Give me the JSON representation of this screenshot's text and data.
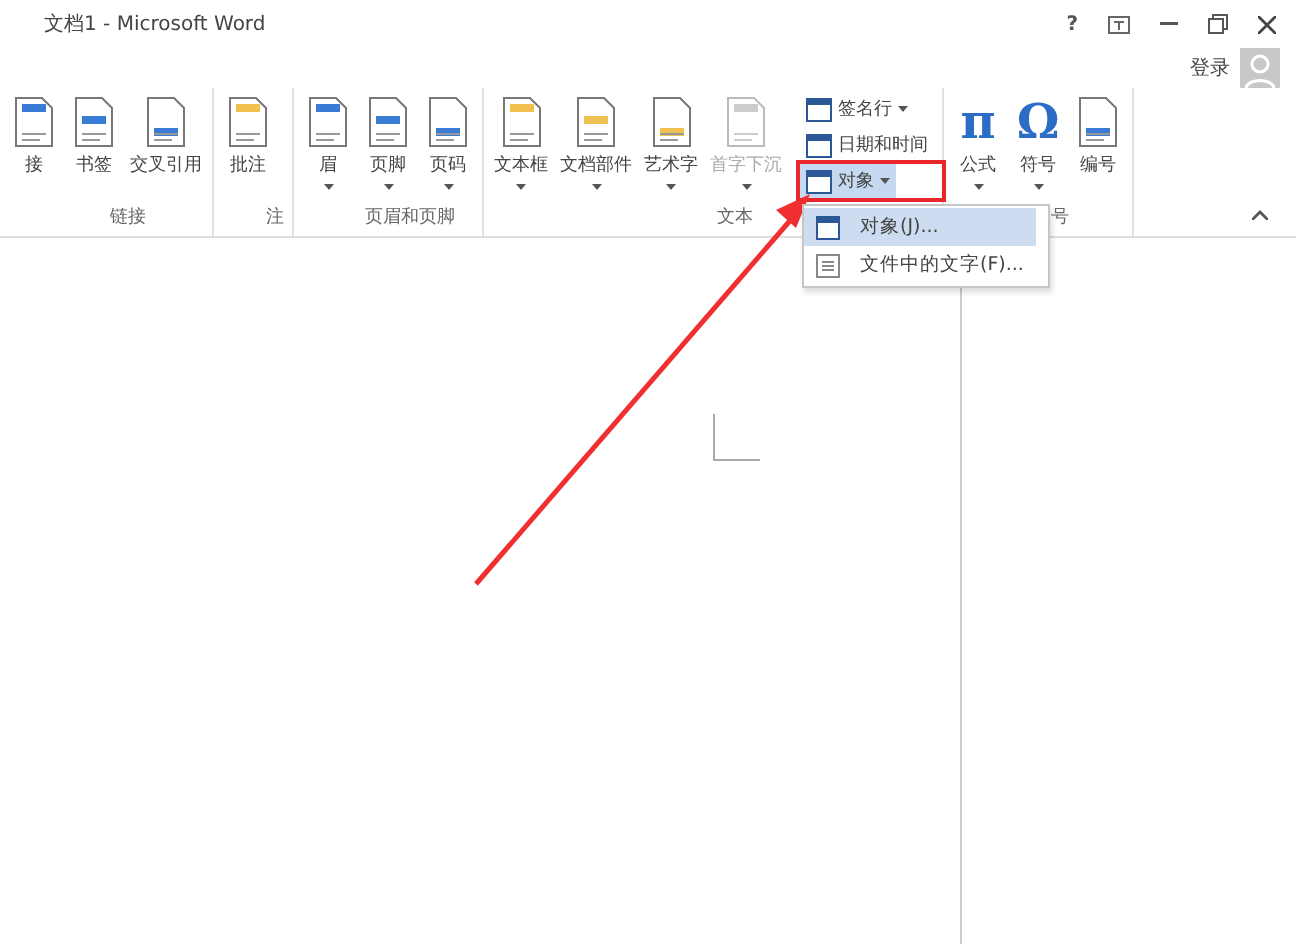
{
  "window": {
    "title": "文档1 - Microsoft Word",
    "help": "?",
    "sign_in": "登录"
  },
  "ribbon": {
    "groups": [
      {
        "label": "链接",
        "buttons": [
          {
            "label": "接",
            "kind": "large",
            "dropdown": false,
            "disabled": false
          },
          {
            "label": "书签",
            "kind": "large",
            "dropdown": false,
            "disabled": false
          },
          {
            "label": "交叉引用",
            "kind": "large",
            "dropdown": false,
            "disabled": false
          }
        ]
      },
      {
        "label": "注",
        "buttons": [
          {
            "label": "批注",
            "kind": "large",
            "dropdown": false,
            "disabled": false
          }
        ]
      },
      {
        "label": "页眉和页脚",
        "buttons": [
          {
            "label": "眉",
            "kind": "large",
            "dropdown": true,
            "disabled": false
          },
          {
            "label": "页脚",
            "kind": "large",
            "dropdown": true,
            "disabled": false
          },
          {
            "label": "页码",
            "kind": "large",
            "dropdown": true,
            "disabled": false
          }
        ]
      },
      {
        "label": "文本",
        "buttons": [
          {
            "label": "文本框",
            "kind": "large",
            "dropdown": true,
            "disabled": false
          },
          {
            "label": "文档部件",
            "kind": "large",
            "dropdown": true,
            "disabled": false
          },
          {
            "label": "艺术字",
            "kind": "large",
            "dropdown": true,
            "disabled": false
          },
          {
            "label": "首字下沉",
            "kind": "large",
            "dropdown": true,
            "disabled": true
          },
          {
            "label": "签名行",
            "kind": "small",
            "dropdown": true,
            "expanded": false
          },
          {
            "label": "日期和时间",
            "kind": "small",
            "dropdown": false,
            "expanded": false
          },
          {
            "label": "对象",
            "kind": "small",
            "dropdown": true,
            "expanded": true
          }
        ]
      },
      {
        "label": "号",
        "buttons": [
          {
            "label": "公式",
            "kind": "large",
            "dropdown": true,
            "disabled": false,
            "glyph": "π"
          },
          {
            "label": "符号",
            "kind": "large",
            "dropdown": true,
            "disabled": false,
            "glyph": "Ω"
          },
          {
            "label": "编号",
            "kind": "large",
            "dropdown": false,
            "disabled": false
          }
        ]
      }
    ]
  },
  "menu": {
    "items": [
      {
        "label": "对象(J)...",
        "selected": true
      },
      {
        "label": "文件中的文字(F)...",
        "selected": false
      }
    ]
  }
}
